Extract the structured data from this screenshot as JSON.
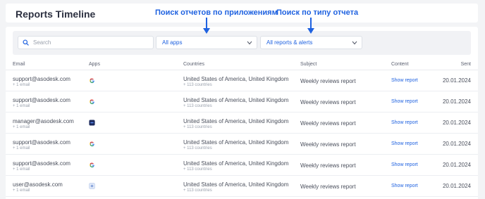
{
  "header": {
    "title": "Reports Timeline"
  },
  "annotations": {
    "apps_filter": "Поиск отчетов по приложениям",
    "type_filter": "Поиск по типу отчета"
  },
  "filters": {
    "search_placeholder": "Search",
    "apps_select": "All apps",
    "type_select": "All reports & alerts"
  },
  "table": {
    "columns": [
      "Email",
      "Apps",
      "Countries",
      "Subject",
      "Content",
      "Sent"
    ],
    "rows": [
      {
        "email": "support@asodesk.com",
        "email_count": "+ 1 email",
        "app_icon": "google-play-icon",
        "countries": "United States of America, United Kingdom",
        "countries_extra": "+ 113 countries",
        "subject": "Weekly reviews report",
        "content": "Show report",
        "sent": "20.01.2024"
      },
      {
        "email": "support@asodesk.com",
        "email_count": "+ 1 email",
        "app_icon": "google-play-icon",
        "countries": "United States of America, United Kingdom",
        "countries_extra": "+ 113 countries",
        "subject": "Weekly reviews report",
        "content": "Show report",
        "sent": "20.01.2024"
      },
      {
        "email": "manager@asodesk.com",
        "email_count": "+ 1 email",
        "app_icon": "dark-app-icon",
        "countries": "United States of America, United Kingdom",
        "countries_extra": "+ 113 countries",
        "subject": "Weekly reviews report",
        "content": "Show report",
        "sent": "20.01.2024"
      },
      {
        "email": "support@asodesk.com",
        "email_count": "+ 1 email",
        "app_icon": "google-play-icon",
        "countries": "United States of America, United Kingdom",
        "countries_extra": "+ 113 countries",
        "subject": "Weekly reviews report",
        "content": "Show report",
        "sent": "20.01.2024"
      },
      {
        "email": "support@asodesk.com",
        "email_count": "+ 1 email",
        "app_icon": "google-play-icon",
        "countries": "United States of America, United Kingdom",
        "countries_extra": "+ 113 countries",
        "subject": "Weekly reviews report",
        "content": "Show report",
        "sent": "20.01.2024"
      },
      {
        "email": "user@asodesk.com",
        "email_count": "+ 1 email",
        "app_icon": "light-app-icon",
        "countries": "United States of America, United Kingdom",
        "countries_extra": "+ 113 countries",
        "subject": "Weekly reviews report",
        "content": "Show report",
        "sent": "20.01.2024"
      }
    ]
  },
  "colors": {
    "accent": "#1f62e0",
    "annotation": "#1f62e0"
  }
}
